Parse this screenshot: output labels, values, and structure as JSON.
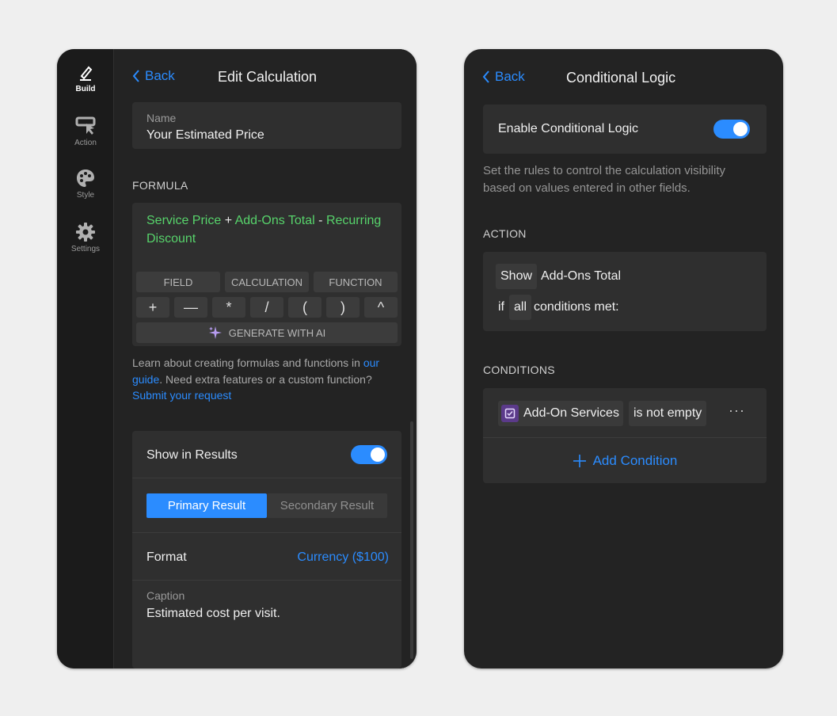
{
  "colors": {
    "accent": "#2b8cff",
    "field_token": "#57d36b",
    "panel_bg": "#232323",
    "card_bg": "#2f2f2f",
    "page_bg": "#efefef"
  },
  "sidebar": {
    "items": [
      {
        "label": "Build",
        "icon": "pencil-icon",
        "active": true
      },
      {
        "label": "Action",
        "icon": "action-icon",
        "active": false
      },
      {
        "label": "Style",
        "icon": "palette-icon",
        "active": false
      },
      {
        "label": "Settings",
        "icon": "gear-icon",
        "active": false
      }
    ]
  },
  "edit_calc": {
    "back_label": "Back",
    "title": "Edit Calculation",
    "name_caption": "Name",
    "name_value": "Your Estimated Price",
    "formula_label": "FORMULA",
    "formula_tokens": [
      "Service Price",
      "+",
      "Add-Ons Total",
      "-",
      "Recurring Discount"
    ],
    "insert_buttons": [
      "FIELD",
      "CALCULATION",
      "FUNCTION"
    ],
    "operator_buttons": [
      "+",
      "—",
      "*",
      "/",
      "(",
      ")",
      "^"
    ],
    "ai_button": "GENERATE WITH AI",
    "help": {
      "part1": "Learn about creating formulas and functions in ",
      "link1": "our guide",
      "part2": ". Need extra features or a custom function? ",
      "link2": "Submit your request"
    },
    "show_in_results_label": "Show in Results",
    "show_in_results_on": true,
    "result_tabs": [
      "Primary Result",
      "Secondary Result"
    ],
    "result_tab_selected": "Primary Result",
    "format_label": "Format",
    "format_value": "Currency ($100)",
    "caption_label": "Caption",
    "caption_value": "Estimated cost per visit."
  },
  "conditional": {
    "back_label": "Back",
    "title": "Conditional Logic",
    "enable_label": "Enable Conditional Logic",
    "enable_on": true,
    "description": "Set the rules to control the calculation visibility based on values entered in other fields.",
    "action_label": "ACTION",
    "action_verb": "Show",
    "action_target": "Add-Ons Total",
    "if_word": "if",
    "match_mode": "all",
    "conditions_met": "conditions met:",
    "conditions_label": "CONDITIONS",
    "condition": {
      "field": "Add-On Services",
      "field_icon": "checkbox-icon",
      "operator": "is not empty"
    },
    "more_label": "···",
    "add_condition_label": "Add Condition"
  }
}
